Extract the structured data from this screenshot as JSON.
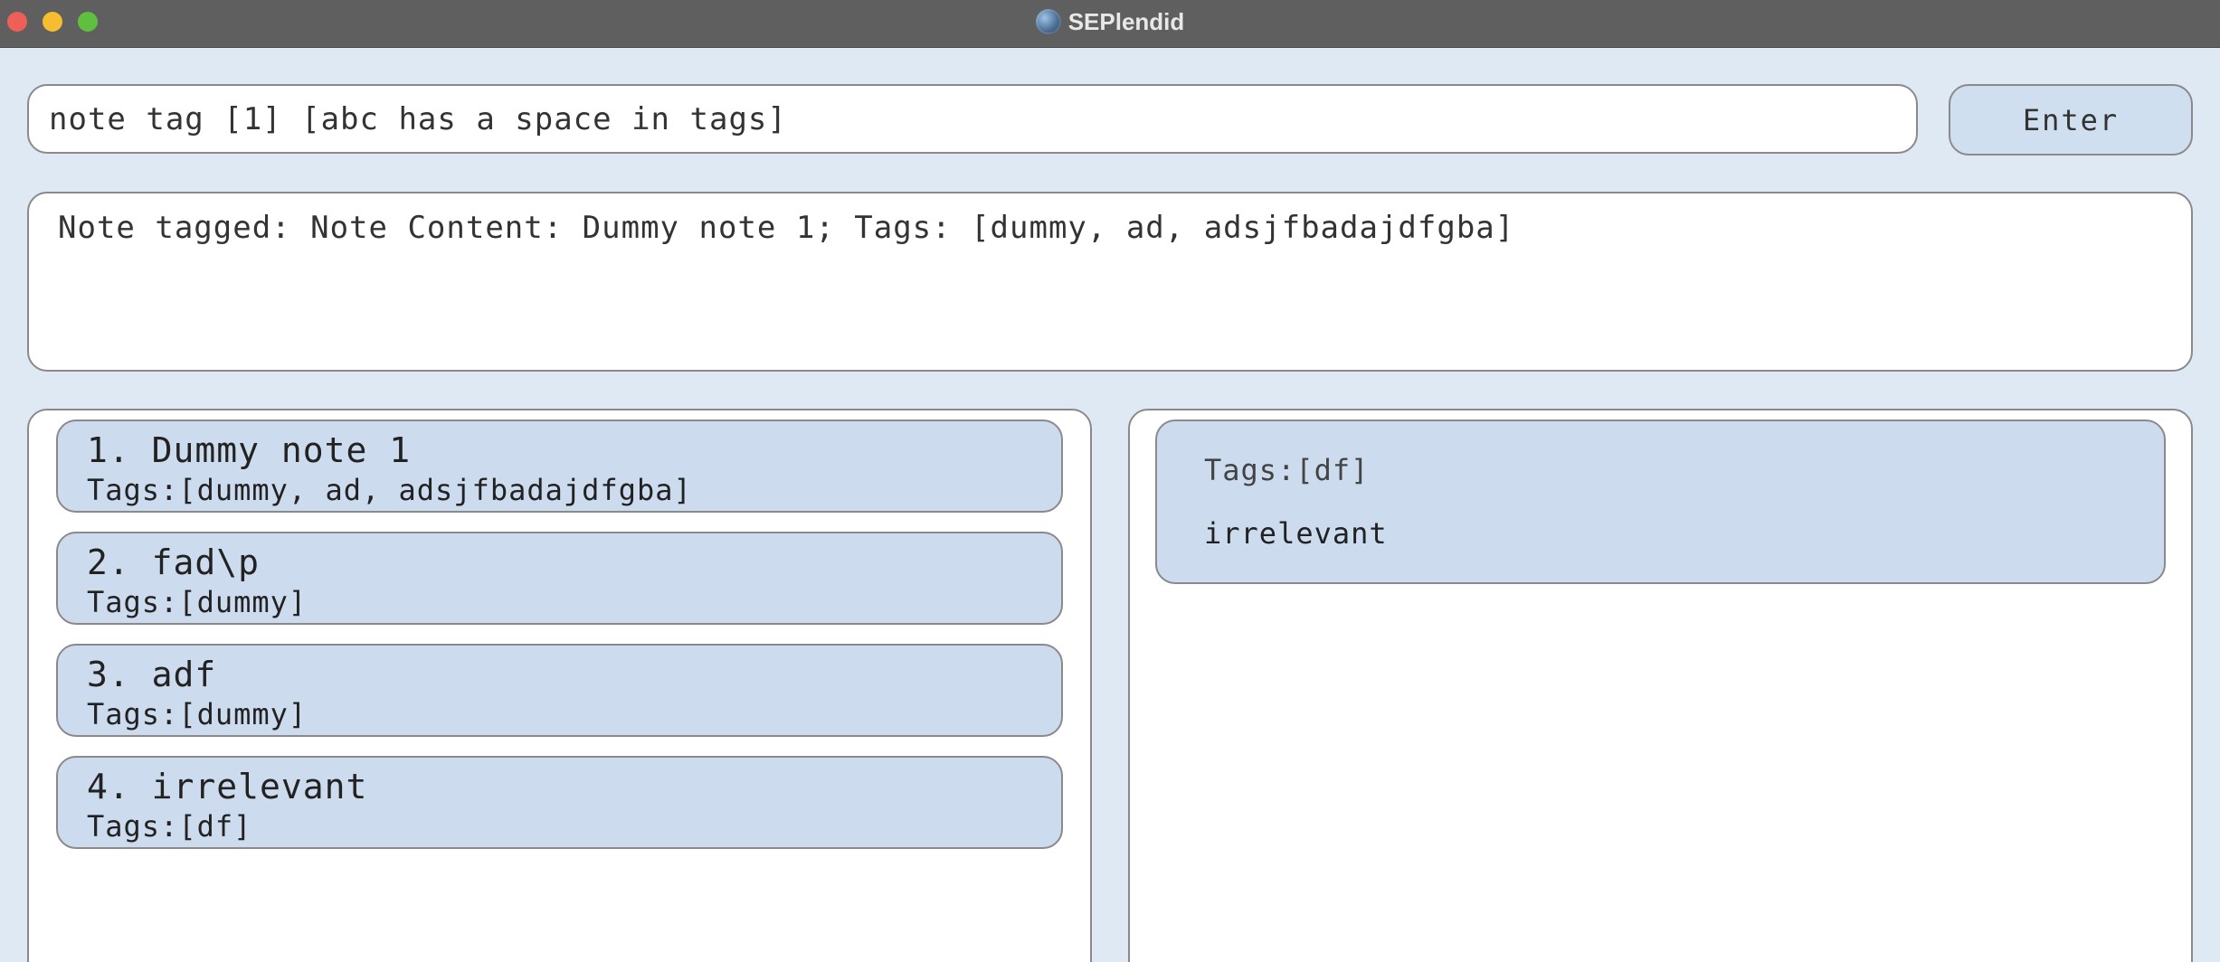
{
  "window": {
    "title": "SEPlendid"
  },
  "command": {
    "input_value": "note tag [1] [abc has a space in tags]",
    "enter_label": "Enter"
  },
  "result": {
    "message": "Note tagged: Note Content: Dummy note 1; Tags: [dummy, ad, adsjfbadajdfgba]"
  },
  "notes": [
    {
      "title": "1. Dummy note 1",
      "tags": "Tags:[dummy, ad, adsjfbadajdfgba]"
    },
    {
      "title": "2. fad\\p",
      "tags": "Tags:[dummy]"
    },
    {
      "title": "3. adf",
      "tags": "Tags:[dummy]"
    },
    {
      "title": "4. irrelevant",
      "tags": "Tags:[df]"
    }
  ],
  "detail": {
    "tags": "Tags:[df]",
    "content": "irrelevant"
  },
  "icons": {
    "close": "close-icon",
    "minimize": "minimize-icon",
    "zoom": "zoom-icon",
    "app": "globe-icon"
  },
  "colors": {
    "background": "#dfe9f3",
    "card": "#ccdcee",
    "titlebar": "#5f5f5f",
    "close": "#ee5f57",
    "minimize": "#f5bd2f",
    "zoom": "#5fc03f"
  }
}
